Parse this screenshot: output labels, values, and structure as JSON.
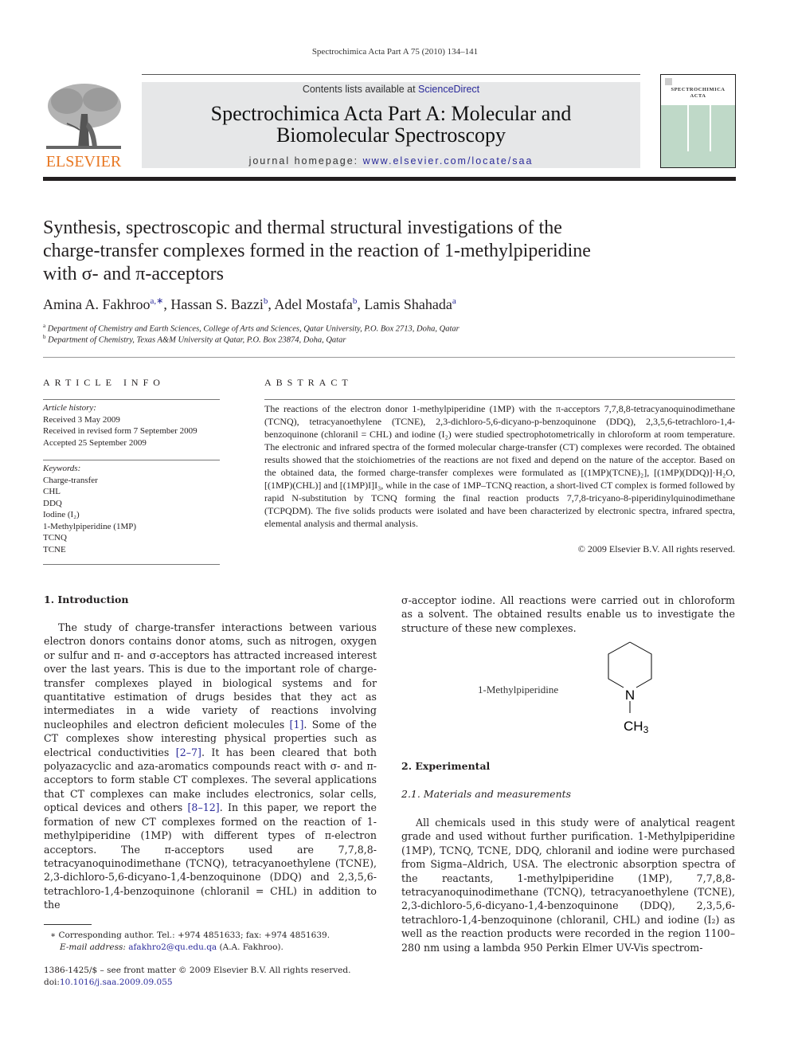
{
  "header": {
    "running_head": "Spectrochimica Acta Part A 75 (2010) 134–141",
    "publisher": "ELSEVIER",
    "contents_prefix": "Contents lists available at ",
    "contents_link": "ScienceDirect",
    "journal_title_line1": "Spectrochimica Acta Part A: Molecular and",
    "journal_title_line2": "Biomolecular Spectroscopy",
    "homepage_prefix": "journal homepage: ",
    "homepage_link": "www.elsevier.com/locate/saa",
    "cover_title_line1": "SPECTROCHIMICA",
    "cover_title_line2": "ACTA",
    "colors": {
      "publisher_orange": "#e87722",
      "link_blue": "#2a2a9a",
      "banner_gray": "#e6e7e8",
      "cover_green": "#bfd9c8"
    }
  },
  "article": {
    "title_line1": "Synthesis, spectroscopic and thermal structural investigations of the",
    "title_line2": "charge-transfer complexes formed in the reaction of 1-methylpiperidine",
    "title_line3": "with σ- and π-acceptors",
    "authors": [
      {
        "name": "Amina A. Fakhroo",
        "sup": "a,∗"
      },
      {
        "name": "Hassan S. Bazzi",
        "sup": "b"
      },
      {
        "name": "Adel Mostafa",
        "sup": "b"
      },
      {
        "name": "Lamis Shahada",
        "sup": "a"
      }
    ],
    "affiliations": [
      {
        "mark": "a",
        "text": "Department of Chemistry and Earth Sciences, College of Arts and Sciences, Qatar University, P.O. Box 2713, Doha, Qatar"
      },
      {
        "mark": "b",
        "text": "Department of Chemistry, Texas A&M University at Qatar, P.O. Box 23874, Doha, Qatar"
      }
    ]
  },
  "article_info": {
    "heading": "ARTICLE INFO",
    "history_label": "Article history:",
    "history": [
      "Received 3 May 2009",
      "Received in revised form 7 September 2009",
      "Accepted 25 September 2009"
    ],
    "keywords_label": "Keywords:",
    "keywords": [
      "Charge-transfer",
      "CHL",
      "DDQ",
      "Iodine (I₂)",
      "1-Methylpiperidine (1MP)",
      "TCNQ",
      "TCNE"
    ]
  },
  "abstract": {
    "heading": "ABSTRACT",
    "text": "The reactions of the electron donor 1-methylpiperidine (1MP) with the π-acceptors 7,7,8,8-tetracyanoquinodimethane (TCNQ), tetracyanoethylene (TCNE), 2,3-dichloro-5,6-dicyano-p-benzoquinone (DDQ), 2,3,5,6-tetrachloro-1,4-benzoquinone (chloranil = CHL) and iodine (I₂) were studied spectrophotometrically in chloroform at room temperature. The electronic and infrared spectra of the formed molecular charge-transfer (CT) complexes were recorded. The obtained results showed that the stoichiometries of the reactions are not fixed and depend on the nature of the acceptor. Based on the obtained data, the formed charge-transfer complexes were formulated as [(1MP)(TCNE)₂], [(1MP)(DDQ)]·H₂O, [(1MP)(CHL)] and [(1MP)I]I₃, while in the case of 1MP–TCNQ reaction, a short-lived CT complex is formed followed by rapid N-substitution by TCNQ forming the final reaction products 7,7,8-tricyano-8-piperidinylquinodimethane (TCPQDM). The five solids products were isolated and have been characterized by electronic spectra, infrared spectra, elemental analysis and thermal analysis.",
    "copyright": "© 2009 Elsevier B.V. All rights reserved."
  },
  "body": {
    "intro_heading": "1.  Introduction",
    "intro_p1_a": "The study of charge-transfer interactions between various electron donors contains donor atoms, such as nitrogen, oxygen or sulfur and π- and σ-acceptors has attracted increased interest over the last years. This is due to the important role of charge-transfer complexes played in biological systems and for quantitative estimation of drugs besides that they act as intermediates in a wide variety of reactions involving nucleophiles and electron deficient molecules ",
    "ref1": "[1]",
    "intro_p1_b": ". Some of the CT complexes show interesting physical properties such as electrical conductivities ",
    "ref2": "[2–7]",
    "intro_p1_c": ". It has been cleared that both polyazacyclic and aza-aromatics compounds react with σ- and π-acceptors to form stable CT complexes. The several applications that CT complexes can make includes electronics, solar cells, optical devices and others ",
    "ref3": "[8–12]",
    "intro_p1_d": ". In this paper, we report the formation of new CT complexes formed on the reaction of 1-methylpiperidine (1MP) with different types of π-electron acceptors. The π-acceptors used are 7,7,8,8-tetracyanoquinodimethane (TCNQ), tetracyanoethylene (TCNE), 2,3-dichloro-5,6-dicyano-1,4-benzoquinone (DDQ) and 2,3,5,6-tetrachloro-1,4-benzoquinone (chloranil = CHL) in addition to the",
    "intro_p1_e": "σ-acceptor iodine. All reactions were carried out in chloroform as a solvent. The obtained results enable us to investigate the structure of these new complexes.",
    "structure_label": "1-Methylpiperidine",
    "structure_atom_n": "N",
    "structure_group": "CH",
    "structure_group_sub": "3",
    "exp_heading": "2.  Experimental",
    "exp_sub_heading": "2.1.  Materials and measurements",
    "exp_p1": "All chemicals used in this study were of analytical reagent grade and used without further purification. 1-Methylpiperidine (1MP), TCNQ, TCNE, DDQ, chloranil and iodine were purchased from Sigma–Aldrich, USA. The electronic absorption spectra of the reactants, 1-methylpiperidine (1MP), 7,7,8,8-tetracyanoquinodimethane (TCNQ), tetracyanoethylene (TCNE), 2,3-dichloro-5,6-dicyano-1,4-benzoquinone (DDQ), 2,3,5,6-tetrachloro-1,4-benzoquinone (chloranil, CHL) and iodine (I₂) as well as the reaction products were recorded in the region 1100–280 nm using a lambda 950 Perkin Elmer UV-Vis spectrom-"
  },
  "footnotes": {
    "corresponding": "∗  Corresponding author. Tel.: +974 4851633; fax: +974 4851639.",
    "email_label": "E-mail address: ",
    "email": "afakhro2@qu.edu.qa",
    "email_suffix": " (A.A. Fakhroo).",
    "issn": "1386-1425/$ – see front matter © 2009 Elsevier B.V. All rights reserved.",
    "doi_prefix": "doi:",
    "doi": "10.1016/j.saa.2009.09.055"
  }
}
